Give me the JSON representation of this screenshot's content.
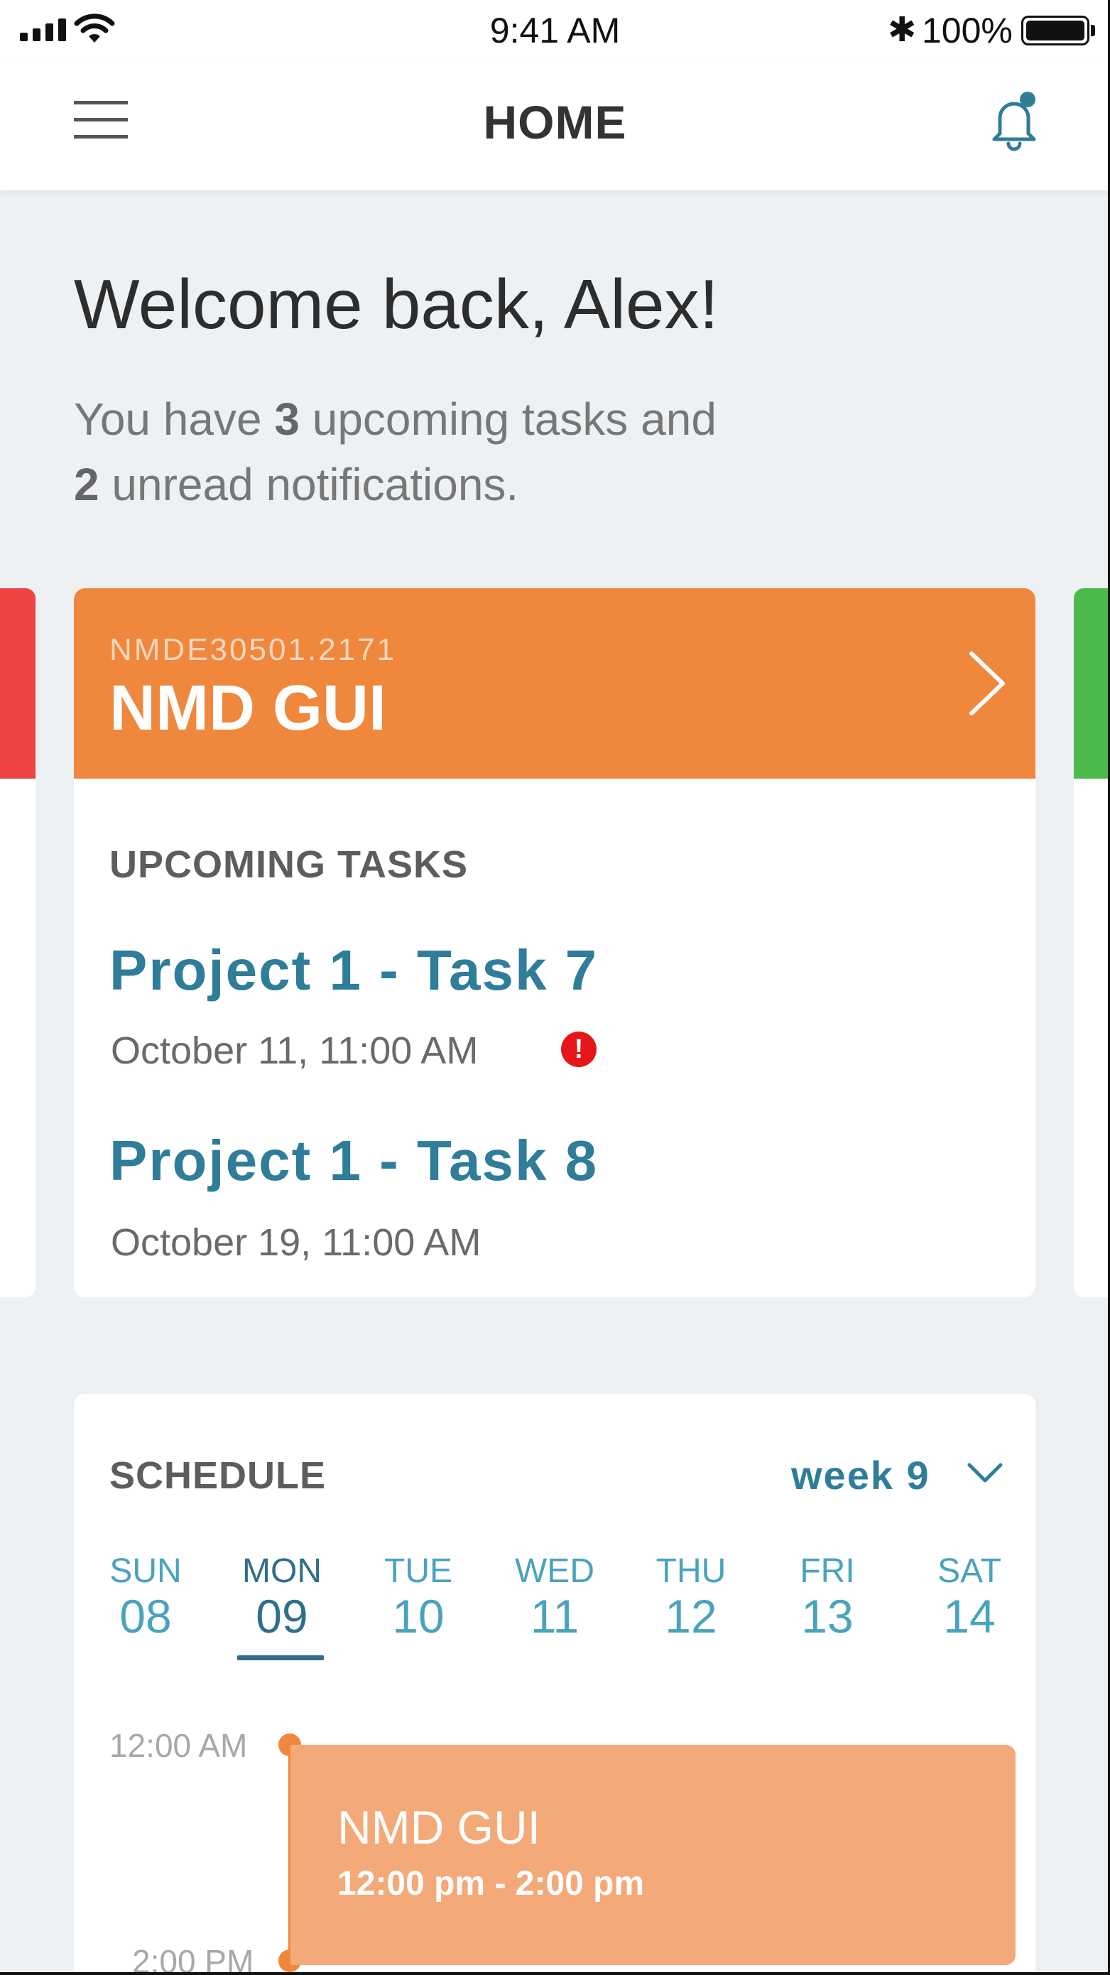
{
  "status_bar": {
    "time": "9:41 AM",
    "bluetooth_symbol": "✱",
    "battery_percent": "100%",
    "icons": [
      "signal-icon",
      "wifi-icon",
      "bluetooth-icon",
      "battery-icon"
    ]
  },
  "nav": {
    "title": "HOME",
    "menu_icon": "hamburger-menu-icon",
    "notification_icon": "bell-icon",
    "notification_dot_color": "#2f7d98"
  },
  "welcome": {
    "heading": "Welcome back, Alex!",
    "line1_prefix": "You have ",
    "task_count": "3",
    "line1_suffix": " upcoming tasks and",
    "notification_count": "2",
    "line2_suffix": " unread notifications."
  },
  "project_card": {
    "code": "NMDE30501.2171",
    "name": "NMD GUI",
    "header_color": "#ef873d",
    "section_label": "UPCOMING TASKS",
    "tasks": [
      {
        "title": "Project 1 - Task 7",
        "date": "October 11, 11:00 AM",
        "alert": "!"
      },
      {
        "title": "Project 1 - Task 8",
        "date": "October 19, 11:00 AM"
      }
    ],
    "side_card_colors": [
      "#f04343",
      "#4cba4a"
    ]
  },
  "schedule": {
    "label": "SCHEDULE",
    "week": "week 9",
    "days": [
      {
        "name": "SUN",
        "date": "08"
      },
      {
        "name": "MON",
        "date": "09"
      },
      {
        "name": "TUE",
        "date": "10"
      },
      {
        "name": "WED",
        "date": "11"
      },
      {
        "name": "THU",
        "date": "12"
      },
      {
        "name": "FRI",
        "date": "13"
      },
      {
        "name": "SAT",
        "date": "14"
      }
    ],
    "selected_day": "MON",
    "time_labels": [
      "12:00 AM",
      "2:00 PM"
    ],
    "event": {
      "title": "NMD GUI",
      "time": "12:00 pm - 2:00 pm"
    }
  }
}
